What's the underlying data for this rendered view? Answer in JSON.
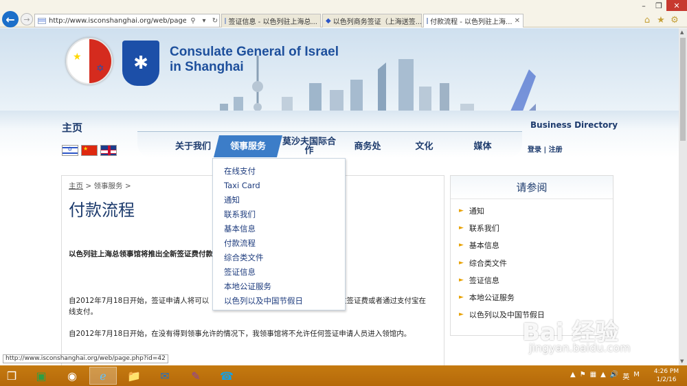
{
  "browser": {
    "url": "http://www.isconshanghai.org/web/page.php?id=42",
    "tabs": [
      {
        "label": "签证信息 - 以色列驻上海总..."
      },
      {
        "label": "以色列商务签证（上海送签..."
      },
      {
        "label": "付款流程 - 以色列驻上海..."
      }
    ],
    "tab_close": "✕"
  },
  "header": {
    "title_line1": "Consulate General of Israel",
    "title_line2": "in Shanghai",
    "home": "主页",
    "business_directory": "Business Directory",
    "login": "登录",
    "separator": "|",
    "register": "注册"
  },
  "nav": {
    "items": [
      {
        "label": "关于我们"
      },
      {
        "label": "领事服务"
      },
      {
        "label": "莫沙夫国际合作"
      },
      {
        "label": "商务处"
      },
      {
        "label": "文化"
      },
      {
        "label": "媒体"
      }
    ]
  },
  "dropdown": {
    "items": [
      "在线支付",
      "Taxi Card",
      "通知",
      "联系我们",
      "基本信息",
      "付款流程",
      "综合类文件",
      "签证信息",
      "本地公证服务",
      "以色列以及中国节假日"
    ]
  },
  "content": {
    "breadcrumb_home": "主页",
    "breadcrumb_sep": ">",
    "breadcrumb_section": "领事服务",
    "breadcrumb_end": ">",
    "title": "付款流程",
    "lead": "以色列驻上海总领事馆将推出全新签证费付款",
    "para1_start": "自2012年7月18日开始，签证申请人将可以",
    "para1_tail": "过签证费或者通过支付宝在",
    "para1_line2": "线支付。",
    "para2": "自2012年7月18日开始，在没有得到领事允许的情况下，我领事馆将不允许任何签证申请人员进入领馆内。"
  },
  "sidebar": {
    "title": "请参阅",
    "items": [
      "通知",
      "联系我们",
      "基本信息",
      "综合类文件",
      "签证信息",
      "本地公证服务",
      "以色列以及中国节假日"
    ]
  },
  "status_bar": {
    "text": "http://www.isconshanghai.org/web/page.php?id=42"
  },
  "watermark": {
    "text": "Bai 经验",
    "sub": "jingyan.baidu.com"
  },
  "taskbar": {
    "clock_time": "4:26 PM",
    "clock_date": "1/2/16",
    "ime": "英",
    "ime2": "M"
  },
  "colors": {
    "nav_active": "#3c7dc8",
    "link": "#1d3b6d",
    "taskbar": "#c57a10"
  }
}
